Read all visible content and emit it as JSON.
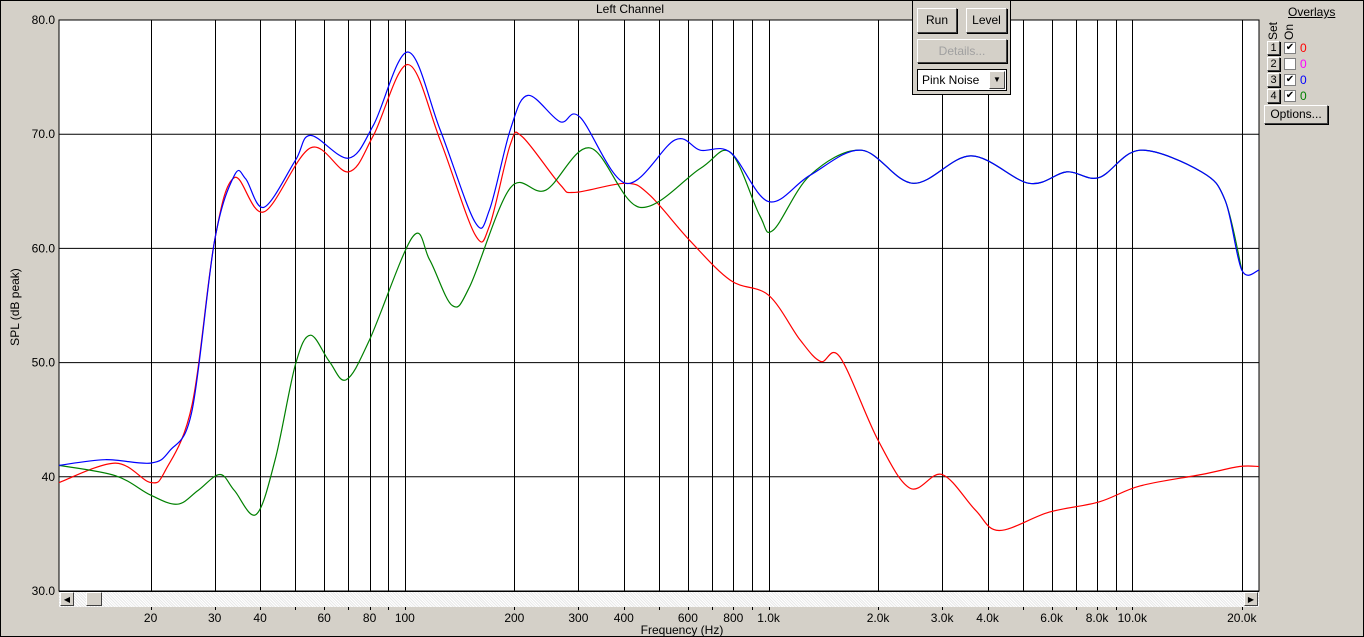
{
  "title": "Left Channel",
  "popup": {
    "run": "Run",
    "level": "Level",
    "details": "Details...",
    "signal": "Pink Noise"
  },
  "overlays": {
    "heading": "Overlays",
    "set_label": "Set",
    "on_label": "On",
    "options": "Options...",
    "items": [
      {
        "set": "1",
        "on": true,
        "count": "0",
        "color": "#ff0000"
      },
      {
        "set": "2",
        "on": false,
        "count": "0",
        "color": "#ff00ff"
      },
      {
        "set": "3",
        "on": true,
        "count": "0",
        "color": "#0000ff"
      },
      {
        "set": "4",
        "on": true,
        "count": "0",
        "color": "#008000"
      }
    ]
  },
  "chart_data": {
    "type": "line",
    "title": "Left Channel",
    "xlabel": "Frequency (Hz)",
    "ylabel": "SPL (dB peak)",
    "xscale": "log",
    "xlim": [
      11.2,
      22300
    ],
    "ylim": [
      30,
      80
    ],
    "grid": true,
    "yticks": [
      {
        "v": 30,
        "l": "30.0"
      },
      {
        "v": 40,
        "l": "40"
      },
      {
        "v": 50,
        "l": "50.0"
      },
      {
        "v": 60,
        "l": "60.0"
      },
      {
        "v": 70,
        "l": "70.0"
      },
      {
        "v": 80,
        "l": "80.0"
      }
    ],
    "xgrid": [
      20,
      30,
      40,
      50,
      60,
      70,
      80,
      90,
      100,
      200,
      300,
      400,
      500,
      600,
      700,
      800,
      900,
      1000,
      2000,
      3000,
      4000,
      5000,
      6000,
      7000,
      8000,
      9000,
      10000,
      20000
    ],
    "xticks": [
      {
        "v": 20,
        "l": "20"
      },
      {
        "v": 30,
        "l": "30"
      },
      {
        "v": 40,
        "l": "40"
      },
      {
        "v": 60,
        "l": "60"
      },
      {
        "v": 80,
        "l": "80"
      },
      {
        "v": 100,
        "l": "100"
      },
      {
        "v": 200,
        "l": "200"
      },
      {
        "v": 300,
        "l": "300"
      },
      {
        "v": 400,
        "l": "400"
      },
      {
        "v": 600,
        "l": "600"
      },
      {
        "v": 800,
        "l": "800"
      },
      {
        "v": 1000,
        "l": "1.0k"
      },
      {
        "v": 2000,
        "l": "2.0k"
      },
      {
        "v": 3000,
        "l": "3.0k"
      },
      {
        "v": 4000,
        "l": "4.0k"
      },
      {
        "v": 6000,
        "l": "6.0k"
      },
      {
        "v": 8000,
        "l": "8.0k"
      },
      {
        "v": 10000,
        "l": "10.0k"
      },
      {
        "v": 20000,
        "l": "20.0k"
      }
    ],
    "series": [
      {
        "name": "Overlay 1",
        "color": "#ff0000",
        "points": [
          [
            11.2,
            39.5
          ],
          [
            16,
            41.2
          ],
          [
            20,
            39.5
          ],
          [
            22,
            40.6
          ],
          [
            26,
            46.3
          ],
          [
            30,
            60.7
          ],
          [
            34,
            66.2
          ],
          [
            41,
            63.2
          ],
          [
            55,
            68.8
          ],
          [
            70,
            66.7
          ],
          [
            82,
            69.9
          ],
          [
            102,
            76.1
          ],
          [
            125,
            69.5
          ],
          [
            156,
            61.2
          ],
          [
            171,
            62.0
          ],
          [
            195,
            69.1
          ],
          [
            210,
            69.8
          ],
          [
            267,
            65.6
          ],
          [
            293,
            64.9
          ],
          [
            405,
            65.7
          ],
          [
            470,
            64.7
          ],
          [
            607,
            60.7
          ],
          [
            786,
            57.2
          ],
          [
            1000,
            55.9
          ],
          [
            1220,
            52.0
          ],
          [
            1390,
            50.1
          ],
          [
            1570,
            50.5
          ],
          [
            2000,
            43.2
          ],
          [
            2450,
            39.0
          ],
          [
            3000,
            40.2
          ],
          [
            3700,
            37.1
          ],
          [
            4300,
            35.3
          ],
          [
            5900,
            36.9
          ],
          [
            8100,
            37.8
          ],
          [
            10500,
            39.2
          ],
          [
            15500,
            40.2
          ],
          [
            19700,
            40.9
          ],
          [
            22300,
            40.9
          ]
        ]
      },
      {
        "name": "Overlay 4",
        "color": "#008000",
        "points": [
          [
            11.2,
            41.0
          ],
          [
            16,
            40.1
          ],
          [
            20,
            38.4
          ],
          [
            23.7,
            37.6
          ],
          [
            27,
            38.8
          ],
          [
            31,
            40.2
          ],
          [
            34,
            38.8
          ],
          [
            39,
            36.7
          ],
          [
            44,
            41.5
          ],
          [
            50,
            49.8
          ],
          [
            55,
            52.4
          ],
          [
            62,
            50.1
          ],
          [
            69,
            48.5
          ],
          [
            80,
            52.0
          ],
          [
            105,
            61.0
          ],
          [
            117,
            59.0
          ],
          [
            135,
            55.0
          ],
          [
            151,
            56.7
          ],
          [
            195,
            65.3
          ],
          [
            244,
            65.1
          ],
          [
            323,
            68.8
          ],
          [
            442,
            63.6
          ],
          [
            649,
            67.0
          ],
          [
            786,
            68.4
          ],
          [
            945,
            62.9
          ],
          [
            1030,
            61.6
          ],
          [
            1300,
            66.4
          ],
          [
            1800,
            68.6
          ],
          [
            2500,
            65.7
          ],
          [
            3600,
            68.1
          ],
          [
            5200,
            65.7
          ],
          [
            6600,
            66.7
          ],
          [
            8100,
            66.2
          ],
          [
            10500,
            68.6
          ],
          [
            15500,
            66.7
          ],
          [
            18000,
            64.2
          ],
          [
            20000,
            58.1
          ]
        ]
      },
      {
        "name": "Overlay 3",
        "color": "#0000ff",
        "points": [
          [
            11.2,
            41.0
          ],
          [
            15,
            41.5
          ],
          [
            20,
            41.2
          ],
          [
            22.6,
            42.3
          ],
          [
            26,
            45.8
          ],
          [
            30,
            60.7
          ],
          [
            34,
            66.4
          ],
          [
            36.5,
            66.1
          ],
          [
            41,
            63.6
          ],
          [
            50,
            67.7
          ],
          [
            55,
            69.9
          ],
          [
            70,
            67.9
          ],
          [
            82,
            70.8
          ],
          [
            102,
            77.2
          ],
          [
            125,
            70.4
          ],
          [
            156,
            62.3
          ],
          [
            171,
            63.4
          ],
          [
            195,
            70.4
          ],
          [
            218,
            73.4
          ],
          [
            267,
            71.1
          ],
          [
            303,
            71.5
          ],
          [
            405,
            65.7
          ],
          [
            553,
            69.5
          ],
          [
            649,
            68.6
          ],
          [
            786,
            68.4
          ],
          [
            1000,
            64.1
          ],
          [
            1300,
            66.4
          ],
          [
            1800,
            68.6
          ],
          [
            2500,
            65.7
          ],
          [
            3600,
            68.1
          ],
          [
            5200,
            65.7
          ],
          [
            6600,
            66.7
          ],
          [
            8100,
            66.2
          ],
          [
            10500,
            68.6
          ],
          [
            15500,
            66.7
          ],
          [
            18000,
            64.2
          ],
          [
            20000,
            58.1
          ],
          [
            22300,
            58.1
          ]
        ]
      }
    ]
  }
}
